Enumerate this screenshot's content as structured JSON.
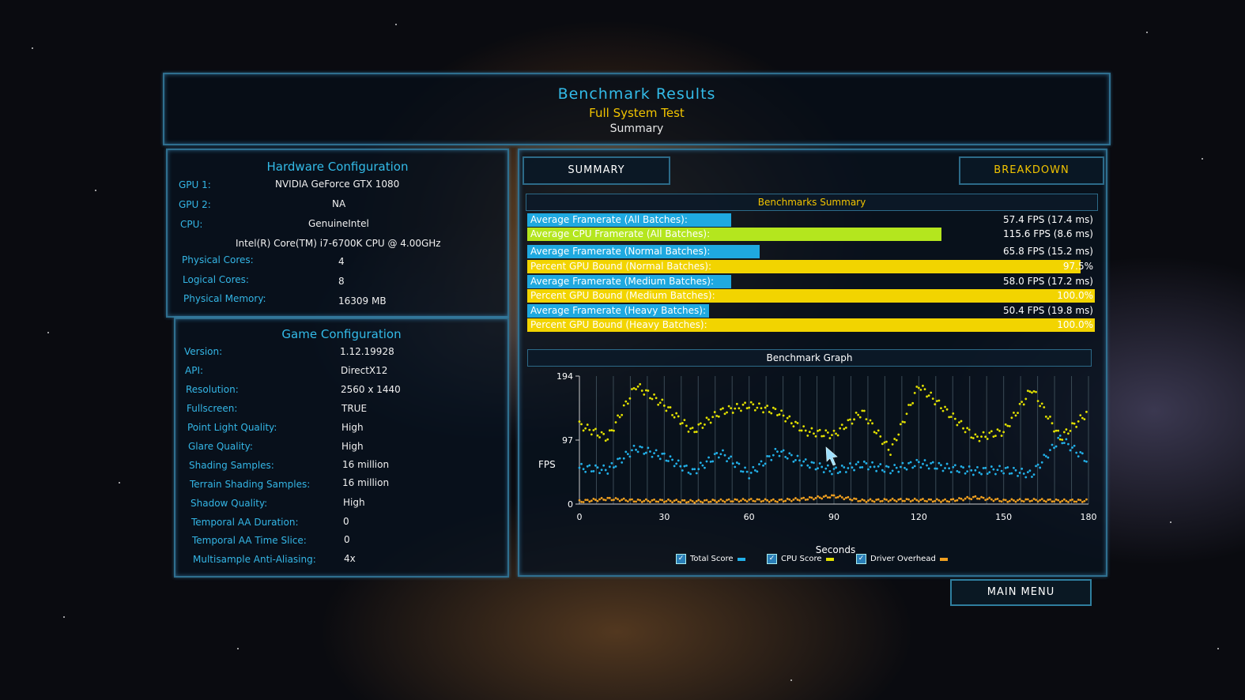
{
  "header": {
    "title": "Benchmark Results",
    "subtitle": "Full System Test",
    "view": "Summary"
  },
  "hardware": {
    "title": "Hardware Configuration",
    "rows": [
      {
        "key": "GPU 1:",
        "value": "NVIDIA GeForce GTX 1080"
      },
      {
        "key": "GPU 2:",
        "value": "NA"
      },
      {
        "key": "CPU:",
        "value": "GenuineIntel"
      },
      {
        "key": "",
        "value": "Intel(R) Core(TM) i7-6700K CPU @ 4.00GHz"
      },
      {
        "key": "Physical Cores:",
        "value": "4"
      },
      {
        "key": "Logical Cores:",
        "value": "8"
      },
      {
        "key": "Physical Memory:",
        "value": "16309  MB"
      }
    ]
  },
  "game": {
    "title": "Game Configuration",
    "rows": [
      {
        "key": "Version:",
        "value": "1.12.19928"
      },
      {
        "key": "API:",
        "value": "DirectX12"
      },
      {
        "key": "Resolution:",
        "value": "2560 x 1440"
      },
      {
        "key": "Fullscreen:",
        "value": "TRUE"
      },
      {
        "key": "Point Light Quality:",
        "value": "High"
      },
      {
        "key": "Glare Quality:",
        "value": "High"
      },
      {
        "key": "Shading Samples:",
        "value": "16 million"
      },
      {
        "key": "Terrain Shading Samples:",
        "value": "16 million"
      },
      {
        "key": "Shadow Quality:",
        "value": "High"
      },
      {
        "key": "Temporal AA Duration:",
        "value": "0"
      },
      {
        "key": "Temporal AA Time Slice:",
        "value": "0"
      },
      {
        "key": "Multisample Anti-Aliasing:",
        "value": "4x"
      }
    ]
  },
  "tabs": {
    "summary": "SUMMARY",
    "breakdown": "BREAKDOWN"
  },
  "summary": {
    "title": "Benchmarks Summary",
    "rows": [
      {
        "label": "Average Framerate (All Batches):",
        "value": "57.4 FPS (17.4 ms)",
        "fill": 0.36,
        "color": "#1fa9e0"
      },
      {
        "label": "Average CPU Framerate (All Batches):",
        "value": "115.6 FPS (8.6 ms)",
        "fill": 0.73,
        "color": "#b4e61e"
      },
      {
        "label": "Average Framerate (Normal Batches):",
        "value": "65.8 FPS (15.2 ms)",
        "fill": 0.41,
        "color": "#1fa9e0"
      },
      {
        "label": "Percent GPU Bound (Normal Batches):",
        "value": "97.5%",
        "fill": 0.975,
        "color": "#f2d400"
      },
      {
        "label": "Average Framerate (Medium Batches):",
        "value": "58.0 FPS (17.2 ms)",
        "fill": 0.36,
        "color": "#1fa9e0"
      },
      {
        "label": "Percent GPU Bound (Medium Batches):",
        "value": "100.0%",
        "fill": 1.0,
        "color": "#f2d400"
      },
      {
        "label": "Average Framerate (Heavy Batches):",
        "value": "50.4 FPS (19.8 ms)",
        "fill": 0.32,
        "color": "#1fa9e0"
      },
      {
        "label": "Percent GPU Bound (Heavy Batches):",
        "value": "100.0%",
        "fill": 1.0,
        "color": "#f2d400"
      }
    ]
  },
  "graph": {
    "title": "Benchmark Graph",
    "xlabel": "Seconds",
    "ylabel": "FPS",
    "legend": [
      {
        "label": "Total Score",
        "color": "#22b0e8"
      },
      {
        "label": "CPU Score",
        "color": "#e2e000"
      },
      {
        "label": "Driver Overhead",
        "color": "#f0a020"
      }
    ]
  },
  "chart_data": {
    "type": "scatter",
    "xlim": [
      0,
      180
    ],
    "ylim": [
      0,
      194
    ],
    "x_ticks": [
      "0",
      "30",
      "60",
      "90",
      "120",
      "150",
      "180"
    ],
    "y_ticks": [
      "0",
      "97",
      "194"
    ],
    "series": [
      {
        "name": "Total Score",
        "x": [
          0,
          10,
          20,
          30,
          40,
          50,
          60,
          70,
          80,
          90,
          100,
          110,
          120,
          130,
          140,
          150,
          160,
          170,
          180
        ],
        "y": [
          55,
          52,
          85,
          72,
          48,
          78,
          45,
          80,
          62,
          50,
          60,
          52,
          62,
          55,
          50,
          52,
          45,
          100,
          65
        ]
      },
      {
        "name": "CPU Score",
        "x": [
          0,
          10,
          20,
          30,
          40,
          50,
          60,
          70,
          80,
          90,
          100,
          110,
          120,
          130,
          140,
          150,
          160,
          170,
          180
        ],
        "y": [
          120,
          100,
          180,
          150,
          110,
          140,
          150,
          140,
          110,
          105,
          140,
          80,
          180,
          140,
          100,
          110,
          175,
          100,
          140
        ]
      },
      {
        "name": "Driver Overhead",
        "x": [
          0,
          10,
          20,
          30,
          40,
          50,
          60,
          70,
          80,
          90,
          100,
          110,
          120,
          130,
          140,
          150,
          160,
          170,
          180
        ],
        "y": [
          4,
          8,
          5,
          5,
          4,
          5,
          6,
          5,
          8,
          12,
          5,
          6,
          6,
          5,
          10,
          5,
          6,
          5,
          5
        ]
      }
    ]
  },
  "buttons": {
    "main_menu": "MAIN MENU"
  }
}
